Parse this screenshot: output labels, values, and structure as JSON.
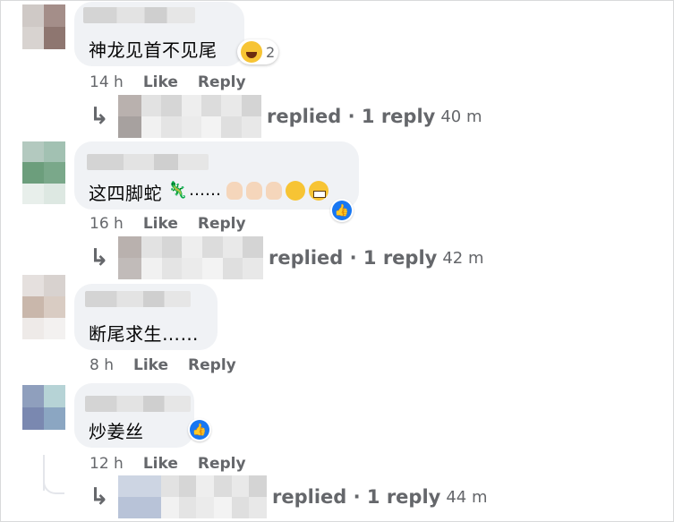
{
  "comments": [
    {
      "text": "神龙见首不见尾",
      "reaction_count": "2",
      "time": "14 h",
      "like_label": "Like",
      "reply_label": "Reply",
      "replies": {
        "text": "replied · 1 reply",
        "time": "40 m"
      }
    },
    {
      "text": "这四脚蛇",
      "ellipsis": "……",
      "time": "16 h",
      "like_label": "Like",
      "reply_label": "Reply",
      "replies": {
        "text": "replied · 1 reply",
        "time": "42 m"
      }
    },
    {
      "text": "断尾求生……",
      "time": "8 h",
      "like_label": "Like",
      "reply_label": "Reply"
    },
    {
      "text": "炒姜丝",
      "time": "12 h",
      "like_label": "Like",
      "reply_label": "Reply",
      "replies": {
        "text": "replied · 1 reply",
        "time": "44 m"
      }
    }
  ],
  "icons": {
    "reply_arrow": "↳",
    "like_reaction": "like-thumb-icon",
    "laugh_reaction": "laughing-emoji-icon"
  },
  "colors": {
    "bubble": "#f0f2f5",
    "meta_text": "#65676b",
    "like_blue": "#1877f2"
  }
}
